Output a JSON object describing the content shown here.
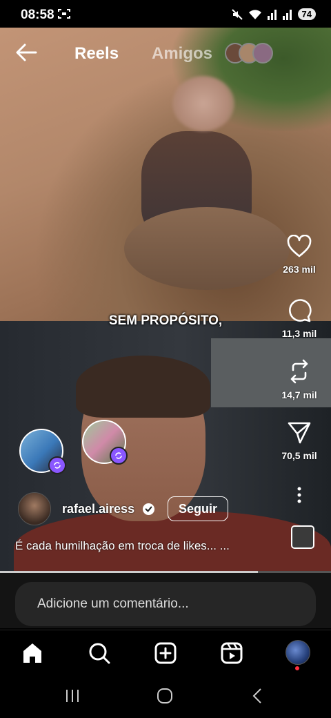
{
  "status_bar": {
    "time": "08:58",
    "battery": "74"
  },
  "top_bar": {
    "tab_reels": "Reels",
    "tab_amigos": "Amigos"
  },
  "video": {
    "overlay_caption": "SEM PROPÓSITO,"
  },
  "actions": {
    "like_count": "263 mil",
    "comment_count": "11,3 mil",
    "repost_count": "14,7 mil",
    "share_count": "70,5 mil"
  },
  "author": {
    "username": "rafael.airess",
    "follow_label": "Seguir"
  },
  "caption": "É cada humilhação em troca de likes... ...",
  "playback": {
    "progress": 0.78
  },
  "comment": {
    "placeholder": "Adicione um comentário..."
  },
  "icons": {
    "back": "arrow-left-icon",
    "like": "heart-icon",
    "comment": "comment-icon",
    "repost": "repost-icon",
    "share": "send-icon",
    "more": "more-vertical-icon",
    "home": "home-icon",
    "search": "search-icon",
    "create": "plus-square-icon",
    "reels": "reels-icon"
  }
}
